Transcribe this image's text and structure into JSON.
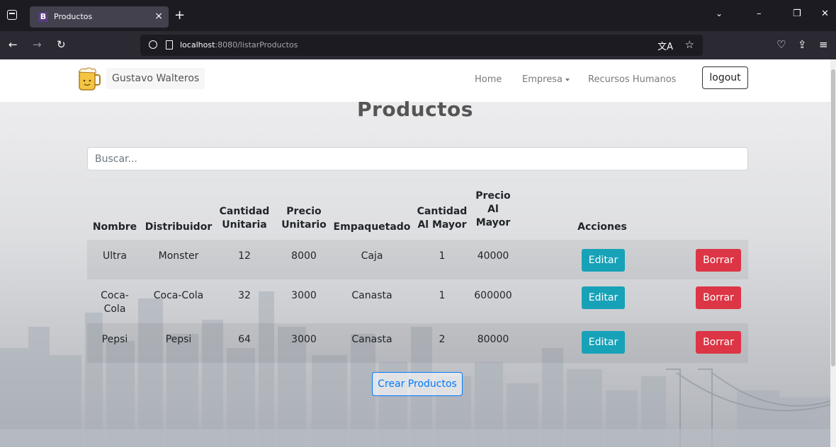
{
  "browser": {
    "tab_title": "Productos",
    "favicon_letter": "B",
    "close_glyph": "×",
    "new_tab_glyph": "+",
    "url_host": "localhost",
    "url_path": ":8080/listarProductos"
  },
  "site": {
    "brand": "Gustavo Walteros",
    "menu": {
      "home": "Home",
      "empresa": "Empresa",
      "rrhh": "Recursos Humanos"
    },
    "logout": "logout"
  },
  "page": {
    "title": "Productos",
    "search_placeholder": "Buscar...",
    "create_button": "Crear Productos"
  },
  "table": {
    "headers": {
      "nombre": "Nombre",
      "distribuidor": "Distribuidor",
      "cantidad_unitaria": [
        "Cantidad",
        "Unitaria"
      ],
      "precio_unitario": [
        "Precio",
        "Unitario"
      ],
      "empaquetado": "Empaquetado",
      "cantidad_mayor": [
        "Cantidad",
        "Al Mayor"
      ],
      "precio_mayor": [
        "Precio",
        "Al",
        "Mayor"
      ],
      "acciones": "Acciones"
    },
    "rows": [
      {
        "nombre": [
          "Ultra"
        ],
        "distribuidor": "Monster",
        "cantidad_unitaria": "12",
        "precio_unitario": "8000",
        "empaquetado": "Caja",
        "cantidad_mayor": "1",
        "precio_mayor": "40000",
        "edit": "Editar",
        "delete": "Borrar"
      },
      {
        "nombre": [
          "Coca-",
          "Cola"
        ],
        "distribuidor": "Coca-Cola",
        "cantidad_unitaria": "32",
        "precio_unitario": "3000",
        "empaquetado": "Canasta",
        "cantidad_mayor": "1",
        "precio_mayor": "600000",
        "edit": "Editar",
        "delete": "Borrar"
      },
      {
        "nombre": [
          "Pepsi"
        ],
        "distribuidor": "Pepsi",
        "cantidad_unitaria": "64",
        "precio_unitario": "3000",
        "empaquetado": "Canasta",
        "cantidad_mayor": "2",
        "precio_mayor": "80000",
        "edit": "Editar",
        "delete": "Borrar"
      }
    ]
  },
  "colors": {
    "edit": "#17a2b8",
    "delete": "#dc3545",
    "primary": "#007bff"
  }
}
